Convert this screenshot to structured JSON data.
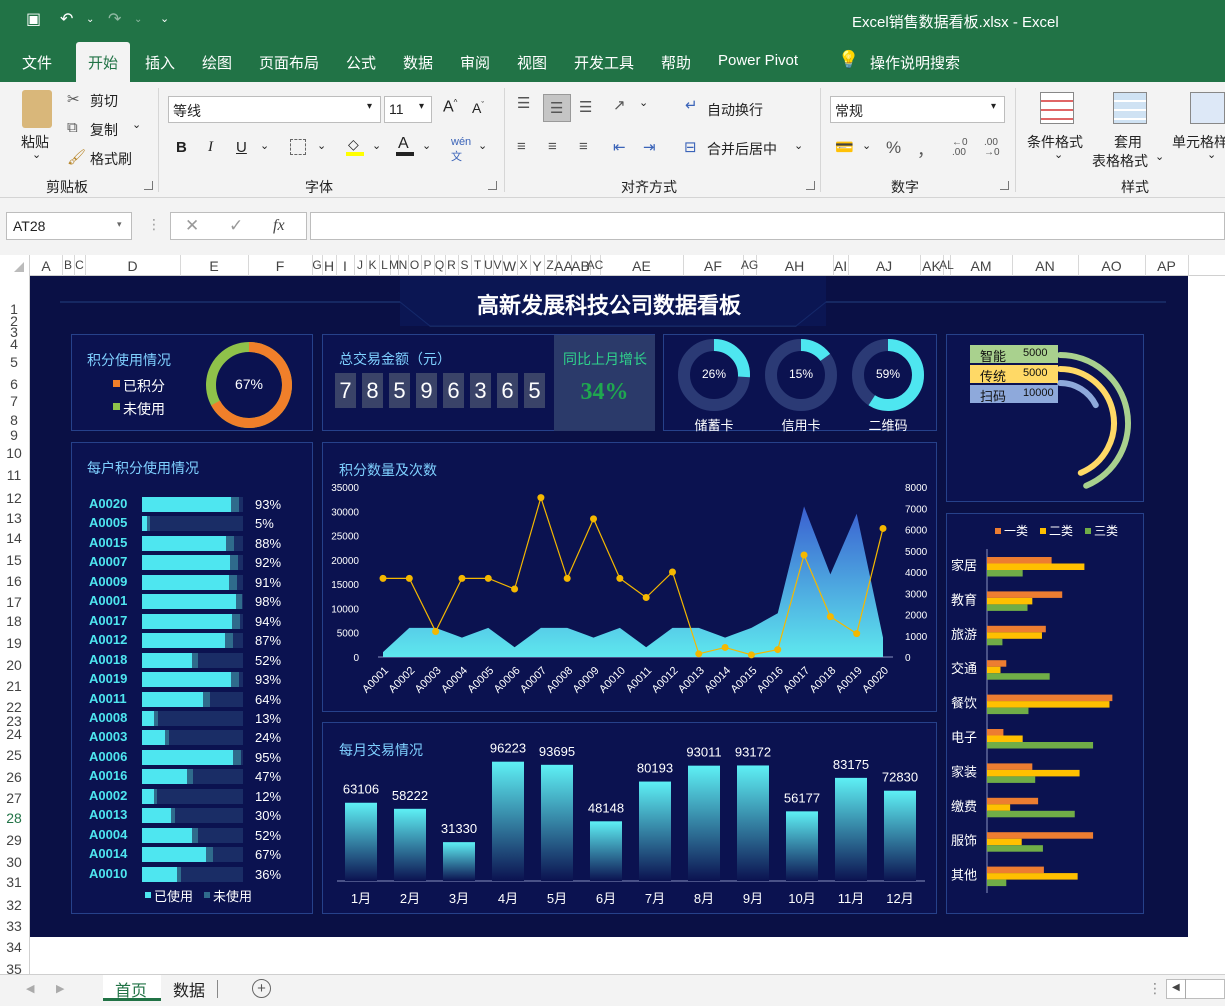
{
  "window": {
    "doc_title": "Excel销售数据看板.xlsx  -  Excel"
  },
  "tabs": [
    "文件",
    "开始",
    "插入",
    "绘图",
    "页面布局",
    "公式",
    "数据",
    "审阅",
    "视图",
    "开发工具",
    "帮助",
    "Power Pivot",
    "操作说明搜索"
  ],
  "active_tab": "开始",
  "ribbon": {
    "paste": "粘贴",
    "cut": "剪切",
    "copy": "复制",
    "format_painter": "格式刷",
    "clipboard": "剪贴板",
    "font_name": "等线",
    "font_size": "11",
    "font_group": "字体",
    "wrap": "自动换行",
    "merge": "合并后居中",
    "align_group": "对齐方式",
    "number_format": "常规",
    "number_group": "数字",
    "cond_format": "条件格式",
    "table_format_1": "套用",
    "table_format_2": "表格格式",
    "cell_style": "单元格样",
    "style_group": "样式",
    "bold": "B",
    "italic": "I",
    "underline": "U",
    "percent": "%",
    "comma": "，"
  },
  "formula_bar": {
    "name_box": "AT28",
    "value": ""
  },
  "columns": [
    "A",
    "B",
    "C",
    "D",
    "E",
    "F",
    "G",
    "H",
    "I",
    "J",
    "K",
    "L",
    "M",
    "N",
    "O",
    "P",
    "Q",
    "R",
    "S",
    "T",
    "U",
    "V",
    "W",
    "X",
    "Y",
    "Z",
    "AA",
    "AB",
    "AC",
    "AE",
    "AF",
    "AG",
    "AH",
    "AI",
    "AJ",
    "AK",
    "AL",
    "AM",
    "AN",
    "AO",
    "AP"
  ],
  "rows": [
    "1",
    "2",
    "3",
    "4",
    "5",
    "6",
    "7",
    "8",
    "9",
    "10",
    "11",
    "12",
    "13",
    "14",
    "15",
    "16",
    "17",
    "18",
    "19",
    "20",
    "21",
    "22",
    "23",
    "24",
    "25",
    "26",
    "27",
    "28",
    "29",
    "30",
    "31",
    "32",
    "33",
    "34",
    "35"
  ],
  "dashboard": {
    "title": "高新发展科技公司数据看板",
    "points_usage": {
      "title": "积分使用情况",
      "legend_used": "已积分",
      "legend_unused": "未使用",
      "percent": "67%",
      "value": 0.67,
      "used_color": "#f07f2a",
      "unused_color": "#8fc24a"
    },
    "total": {
      "title": "总交易金额（元）",
      "digits": [
        "7",
        "8",
        "5",
        "9",
        "6",
        "3",
        "6",
        "5"
      ],
      "growth_title": "同比上月增长",
      "growth": "34%",
      "growth_color": "#1fa84f"
    },
    "cards": [
      {
        "label": "储蓄卡",
        "percent": "26%",
        "value": 0.26
      },
      {
        "label": "信用卡",
        "percent": "15%",
        "value": 0.15
      },
      {
        "label": "二维码",
        "percent": "59%",
        "value": 0.59
      }
    ],
    "channels": [
      {
        "name": "智能",
        "value": "5000",
        "share": 0.62,
        "color": "#a9d18e"
      },
      {
        "name": "传统",
        "value": "5000",
        "share": 0.62,
        "color": "#ffd966"
      },
      {
        "name": "扫码",
        "value": "10000",
        "share": 0.25,
        "color": "#8ea9db"
      }
    ],
    "households": {
      "title": "每户积分使用情况",
      "legend_used": "已使用",
      "legend_unused": "未使用",
      "items": [
        {
          "id": "A0020",
          "pct": "93%",
          "v": 0.93
        },
        {
          "id": "A0005",
          "pct": "5%",
          "v": 0.05
        },
        {
          "id": "A0015",
          "pct": "88%",
          "v": 0.88
        },
        {
          "id": "A0007",
          "pct": "92%",
          "v": 0.92
        },
        {
          "id": "A0009",
          "pct": "91%",
          "v": 0.91
        },
        {
          "id": "A0001",
          "pct": "98%",
          "v": 0.98
        },
        {
          "id": "A0017",
          "pct": "94%",
          "v": 0.94
        },
        {
          "id": "A0012",
          "pct": "87%",
          "v": 0.87
        },
        {
          "id": "A0018",
          "pct": "52%",
          "v": 0.52
        },
        {
          "id": "A0019",
          "pct": "93%",
          "v": 0.93
        },
        {
          "id": "A0011",
          "pct": "64%",
          "v": 0.64
        },
        {
          "id": "A0008",
          "pct": "13%",
          "v": 0.13
        },
        {
          "id": "A0003",
          "pct": "24%",
          "v": 0.24
        },
        {
          "id": "A0006",
          "pct": "95%",
          "v": 0.95
        },
        {
          "id": "A0016",
          "pct": "47%",
          "v": 0.47
        },
        {
          "id": "A0002",
          "pct": "12%",
          "v": 0.12
        },
        {
          "id": "A0013",
          "pct": "30%",
          "v": 0.3
        },
        {
          "id": "A0004",
          "pct": "52%",
          "v": 0.52
        },
        {
          "id": "A0014",
          "pct": "67%",
          "v": 0.67
        },
        {
          "id": "A0010",
          "pct": "36%",
          "v": 0.36
        }
      ]
    },
    "monthly_title": "每月交易情况",
    "points_chart_title": "积分数量及次数",
    "category_legend": [
      "一类",
      "二类",
      "三类"
    ]
  },
  "chart_data": [
    {
      "type": "line",
      "title": "积分数量及次数",
      "categories": [
        "A0001",
        "A0002",
        "A0003",
        "A0004",
        "A0005",
        "A0006",
        "A0007",
        "A0008",
        "A0009",
        "A0010",
        "A0011",
        "A0012",
        "A0013",
        "A0014",
        "A0015",
        "A0016",
        "A0017",
        "A0018",
        "A0019",
        "A0020"
      ],
      "y_left_ticks": [
        "35000",
        "30000",
        "25000",
        "20000",
        "15000",
        "10000",
        "5000",
        "0"
      ],
      "y_right_ticks": [
        "8000",
        "7000",
        "6000",
        "5000",
        "4000",
        "3000",
        "2000",
        "1000",
        "0"
      ],
      "ylim_left": [
        0,
        35000
      ],
      "ylim_right": [
        0,
        8000
      ],
      "series": [
        {
          "kind": "area",
          "axis": "left",
          "values": [
            1000,
            6000,
            6000,
            4000,
            6000,
            2000,
            6000,
            6000,
            4000,
            6000,
            2000,
            6000,
            6000,
            4000,
            6000,
            9000,
            31000,
            17000,
            29500,
            4000
          ]
        },
        {
          "kind": "line",
          "axis": "right",
          "values": [
            3700,
            3700,
            1200,
            3700,
            3700,
            3200,
            7500,
            3700,
            6500,
            3700,
            2800,
            4000,
            150,
            450,
            100,
            350,
            4800,
            1900,
            1100,
            6050
          ]
        }
      ]
    },
    {
      "type": "bar",
      "title": "每月交易情况",
      "categories": [
        "1月",
        "2月",
        "3月",
        "4月",
        "5月",
        "6月",
        "7月",
        "8月",
        "9月",
        "10月",
        "11月",
        "12月"
      ],
      "values": [
        63106,
        58222,
        31330,
        96223,
        93695,
        48148,
        80193,
        93011,
        93172,
        56177,
        83175,
        72830
      ],
      "labels": [
        "63106",
        "58222",
        "31330",
        "96223",
        "93695",
        "48148",
        "80193",
        "93011",
        "93172",
        "56177",
        "83175",
        "72830"
      ],
      "ylim": [
        0,
        100000
      ]
    },
    {
      "type": "bar",
      "orientation": "horizontal",
      "categories": [
        "家居",
        "教育",
        "旅游",
        "交通",
        "餐饮",
        "电子",
        "家装",
        "缴费",
        "服饰",
        "其他"
      ],
      "series": [
        {
          "name": "一类",
          "color": "#ed7d31",
          "values": [
            67,
            78,
            61,
            20,
            130,
            17,
            47,
            53,
            110,
            59
          ]
        },
        {
          "name": "二类",
          "color": "#ffc000",
          "values": [
            101,
            47,
            57,
            14,
            127,
            37,
            96,
            24,
            36,
            94
          ]
        },
        {
          "name": "三类",
          "color": "#70ad47",
          "values": [
            37,
            42,
            16,
            65,
            43,
            110,
            50,
            91,
            58,
            20
          ]
        }
      ],
      "xlim": [
        0,
        140
      ]
    }
  ],
  "sheets": [
    "首页",
    "数据"
  ],
  "active_sheet": "首页"
}
